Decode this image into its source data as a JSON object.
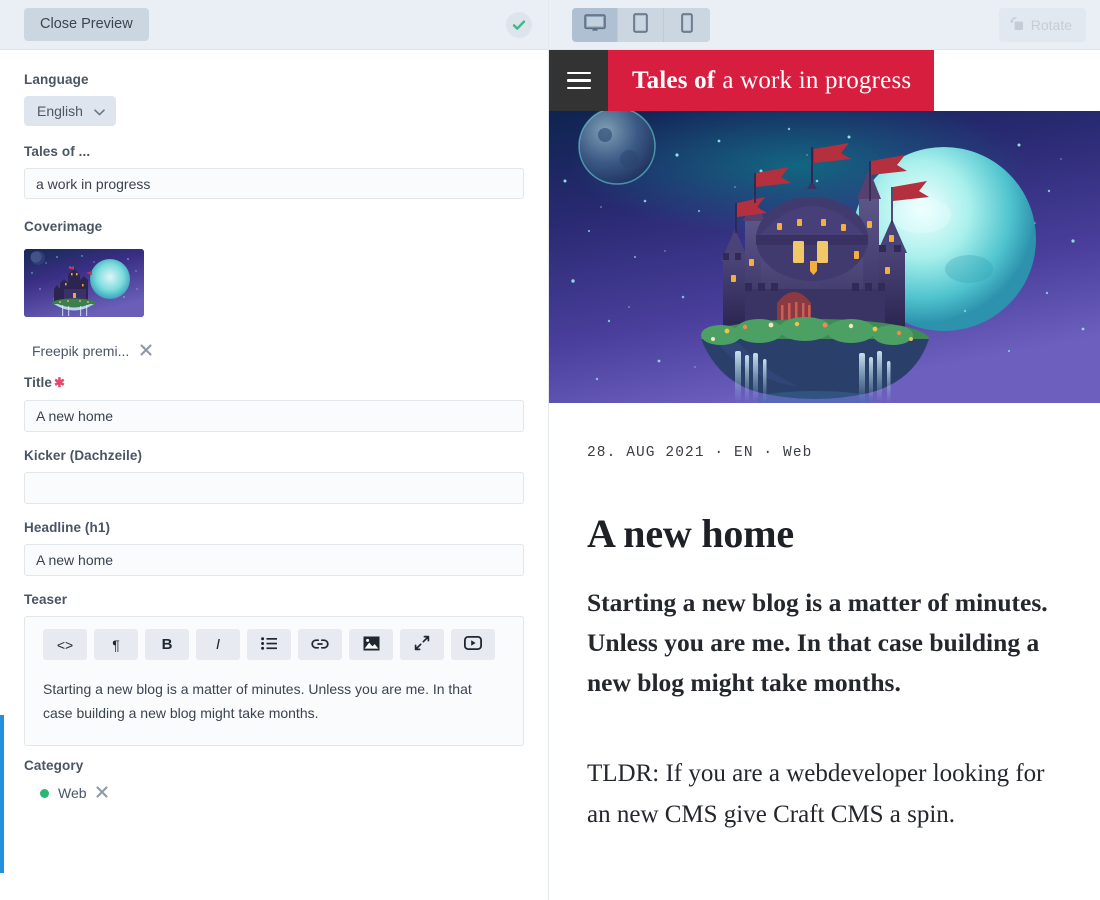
{
  "editor": {
    "topbar": {
      "close_preview_label": "Close Preview",
      "status_icon": "check-circle-icon",
      "status_color": "#3fb68b"
    },
    "fields": {
      "language": {
        "label": "Language",
        "value": "English",
        "chevron_icon": "chevron-down-icon"
      },
      "tales_of": {
        "label": "Tales of ...",
        "value": "a work in progress",
        "placeholder": ""
      },
      "coverimage": {
        "label": "Coverimage",
        "thumbnail_alt": "castle-thumbnail",
        "asset_name": "Freepik premi...",
        "remove_icon": "close-x-icon"
      },
      "title": {
        "label": "Title",
        "required_marker": "✱",
        "value": "A new home",
        "placeholder": ""
      },
      "kicker": {
        "label": "Kicker (Dachzeile)",
        "value": "",
        "placeholder": ""
      },
      "headline": {
        "label": "Headline (h1)",
        "value": "A new home",
        "placeholder": ""
      },
      "teaser": {
        "label": "Teaser",
        "content": "Starting a new blog is a matter of minutes. Unless you are me. In that case building a new blog might take months.",
        "toolbar": [
          {
            "name": "source-code-icon",
            "glyph": "<>",
            "title": "Code"
          },
          {
            "name": "paragraph-icon",
            "glyph": "¶",
            "title": "Paragraph"
          },
          {
            "name": "bold-icon",
            "glyph": "B",
            "title": "Bold"
          },
          {
            "name": "italic-icon",
            "glyph": "I",
            "title": "Italic"
          },
          {
            "name": "bullet-list-icon",
            "glyph": "",
            "title": "Bullet list"
          },
          {
            "name": "link-icon",
            "glyph": "",
            "title": "Link"
          },
          {
            "name": "image-icon",
            "glyph": "",
            "title": "Image"
          },
          {
            "name": "expand-icon",
            "glyph": "",
            "title": "Expand"
          },
          {
            "name": "video-icon",
            "glyph": "",
            "title": "Video"
          }
        ]
      },
      "category": {
        "label": "Category",
        "selected": "Web",
        "dot_color": "#2bb673",
        "remove_icon": "close-x-icon"
      }
    }
  },
  "preview": {
    "topbar": {
      "devices": [
        {
          "name": "desktop-view-button",
          "icon": "desktop-icon",
          "active": true
        },
        {
          "name": "tablet-view-button",
          "icon": "tablet-icon",
          "active": false
        },
        {
          "name": "phone-view-button",
          "icon": "phone-icon",
          "active": false
        }
      ],
      "rotate_label": "Rotate",
      "rotate_icon": "rotate-icon",
      "rotate_disabled": true
    },
    "site": {
      "menu_icon": "hamburger-menu-icon",
      "title_bold": "Tales of",
      "title_regular": "a work in progress",
      "brand_color": "#d81e3f",
      "menu_bg": "#333333"
    },
    "hero": {
      "alt": "floating-castle-hero-image"
    },
    "article": {
      "meta": "28. AUG 2021  ·  EN  ·  Web",
      "title": "A new home",
      "teaser": "Starting a new blog is a matter of minutes. Unless you are me. In that case building a new blog might take months.",
      "body": "TLDR: If you are a webdeveloper looking for an new CMS give Craft CMS a spin."
    }
  }
}
